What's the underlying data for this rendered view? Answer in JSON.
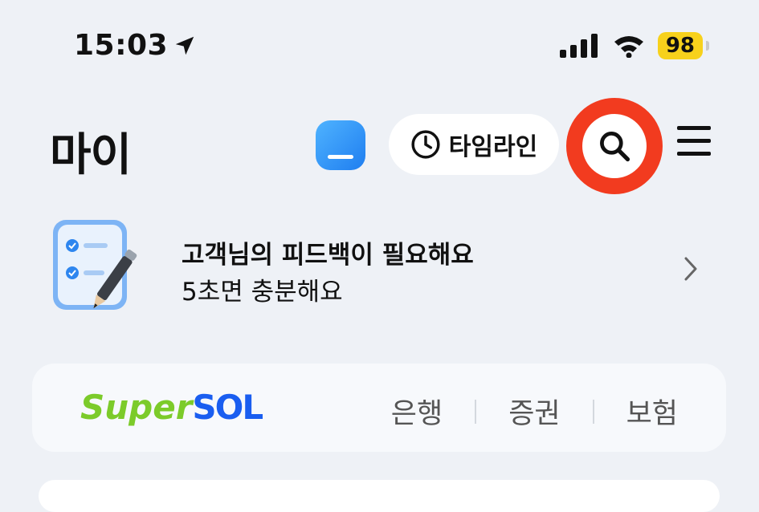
{
  "status": {
    "time": "15:03",
    "battery": "98"
  },
  "header": {
    "title": "마이",
    "timeline_label": "타임라인"
  },
  "feedback": {
    "title": "고객님의 피드백이 필요해요",
    "subtitle": "5초면 충분해요"
  },
  "supersol": {
    "logo_super": "Super",
    "logo_sol": "SOL",
    "links": [
      "은행",
      "증권",
      "보험"
    ]
  },
  "colors": {
    "background": "#eef1f6",
    "highlight_ring": "#f23b1f",
    "battery": "#f7d11c"
  }
}
